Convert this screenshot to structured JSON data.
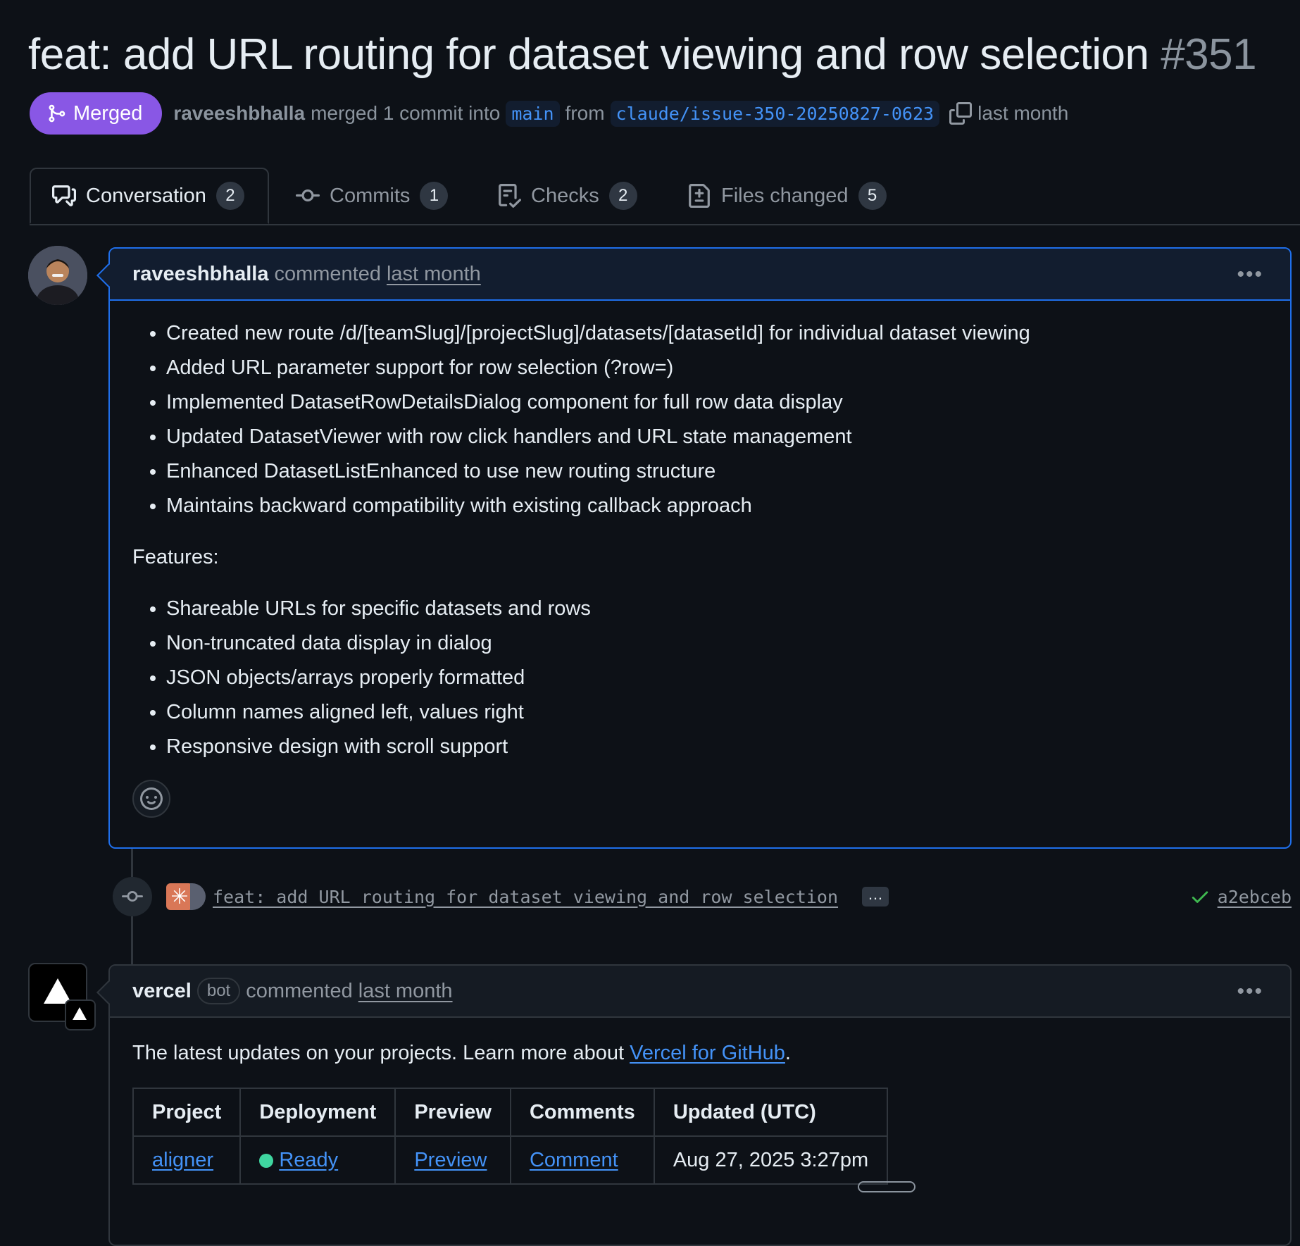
{
  "pr": {
    "title": "feat: add URL routing for dataset viewing and row selection",
    "number": "#351",
    "state": "Merged",
    "author": "raveeshbhalla",
    "merged_text": "merged 1 commit into",
    "base_branch": "main",
    "from_text": "from",
    "head_branch": "claude/issue-350-20250827-0623",
    "time": "last month"
  },
  "tabs": [
    {
      "label": "Conversation",
      "count": "2",
      "icon": "comment-discussion-icon"
    },
    {
      "label": "Commits",
      "count": "1",
      "icon": "git-commit-icon"
    },
    {
      "label": "Checks",
      "count": "2",
      "icon": "checklist-icon"
    },
    {
      "label": "Files changed",
      "count": "5",
      "icon": "file-diff-icon"
    }
  ],
  "comment1": {
    "author": "raveeshbhalla",
    "action": "commented",
    "time": "last month",
    "bullets": [
      "Created new route /d/[teamSlug]/[projectSlug]/datasets/[datasetId] for individual dataset viewing",
      "Added URL parameter support for row selection (?row=)",
      "Implemented DatasetRowDetailsDialog component for full row data display",
      "Updated DatasetViewer with row click handlers and URL state management",
      "Enhanced DatasetListEnhanced to use new routing structure",
      "Maintains backward compatibility with existing callback approach"
    ],
    "features_heading": "Features:",
    "features": [
      "Shareable URLs for specific datasets and rows",
      "Non-truncated data display in dialog",
      "JSON objects/arrays properly formatted",
      "Column names aligned left, values right",
      "Responsive design with scroll support"
    ]
  },
  "commit": {
    "message": "feat: add URL routing for dataset viewing and row selection",
    "ellipsis": "…",
    "sha": "a2ebceb"
  },
  "comment2": {
    "author": "vercel",
    "bot_label": "bot",
    "action": "commented",
    "time": "last month",
    "intro": "The latest updates on your projects. Learn more about ",
    "intro_link": "Vercel for GitHub",
    "intro_end": ".",
    "table": {
      "headers": [
        "Project",
        "Deployment",
        "Preview",
        "Comments",
        "Updated (UTC)"
      ],
      "row": {
        "project": "aligner",
        "deployment": "Ready",
        "preview": "Preview",
        "comments": "Comment",
        "updated": "Aug 27, 2025 3:27pm"
      }
    }
  },
  "colors": {
    "background": "#0d1117",
    "merged": "#8957e5",
    "link": "#4493f8",
    "ready": "#3fd6a0"
  }
}
